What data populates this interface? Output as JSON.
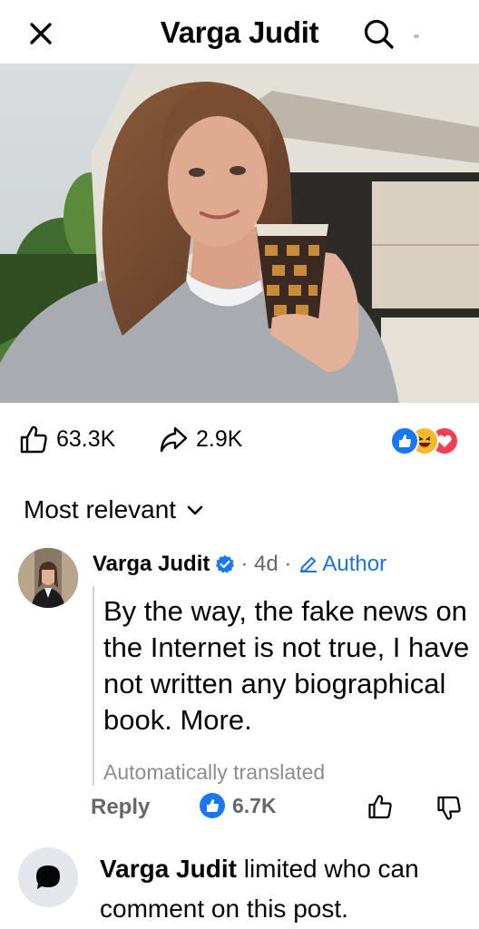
{
  "header": {
    "title": "Varga Judit",
    "close_icon": "close-icon",
    "search_icon": "search-icon"
  },
  "post": {
    "photo": "selfie-with-coffee-cup",
    "likes": "63.3K",
    "shares": "2.9K",
    "reactions": [
      "like",
      "haha",
      "love"
    ]
  },
  "comments": {
    "sort_label": "Most relevant",
    "items": [
      {
        "name": "Varga Judit",
        "verified": true,
        "time": "· 4d ·",
        "badge": "Author",
        "text": "By the way, the fake news on the Internet is not true, I have not written any biographical book. More.",
        "translated": "Automatically translated",
        "reply_label": "Reply",
        "likes": "6.7K"
      }
    ]
  },
  "notice": {
    "name": "Varga Judit",
    "text": " limited who can comment on this post."
  },
  "colors": {
    "accent": "#1b74e4",
    "secondary_text": "#65676b",
    "muted_text": "#8a8d91",
    "like_blue": "#1877f2",
    "love_red": "#f33e58",
    "haha_yellow": "#f7b928"
  }
}
